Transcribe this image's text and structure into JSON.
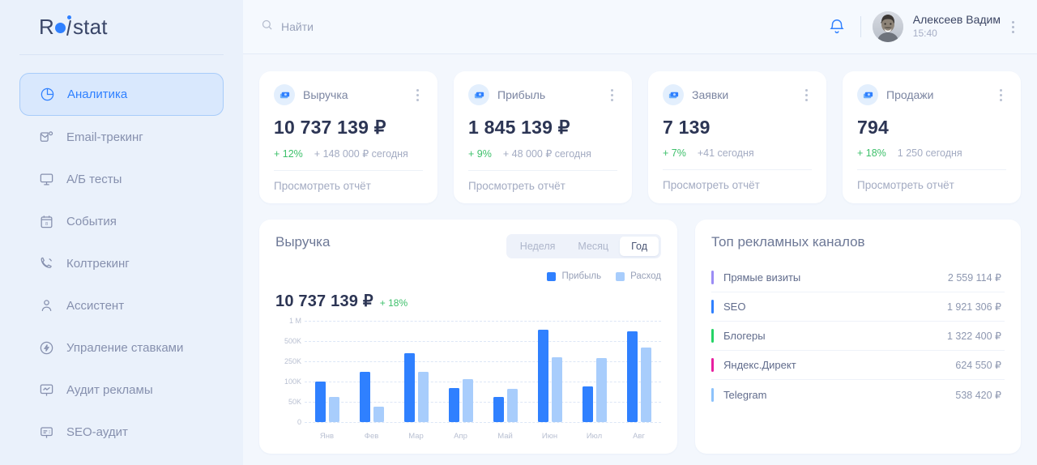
{
  "brand": {
    "logo_text": "Roistat",
    "accent": "#2f80ff"
  },
  "sidebar": {
    "items": [
      {
        "label": "Аналитика",
        "icon": "pie-chart-icon",
        "active": true
      },
      {
        "label": "Email-трекинг",
        "icon": "email-icon",
        "active": false
      },
      {
        "label": "A/Б тесты",
        "icon": "monitor-icon",
        "active": false
      },
      {
        "label": "События",
        "icon": "calendar-icon",
        "active": false
      },
      {
        "label": "Колтрекинг",
        "icon": "phone-icon",
        "active": false
      },
      {
        "label": "Ассистент",
        "icon": "user-check-icon",
        "active": false
      },
      {
        "label": "Упраление ставками",
        "icon": "bolt-circle-icon",
        "active": false
      },
      {
        "label": "Аудит рекламы",
        "icon": "presentation-icon",
        "active": false
      },
      {
        "label": "SEO-аудит",
        "icon": "document-icon",
        "active": false
      }
    ]
  },
  "topbar": {
    "search_placeholder": "Найти",
    "search_icon": "search-icon",
    "bell_icon": "bell-icon",
    "user": {
      "name": "Алексеев Вадим",
      "time": "15:40"
    },
    "menu_icon": "kebab-menu-icon"
  },
  "kpi_cards": [
    {
      "title": "Выручка",
      "value": "10 737 139 ₽",
      "delta": "+ 12%",
      "note": "+ 148 000 ₽ сегодня",
      "link": "Просмотреть отчёт",
      "icon": "money-icon"
    },
    {
      "title": "Прибыль",
      "value": "1 845 139 ₽",
      "delta": "+ 9%",
      "note": "+ 48 000 ₽ сегодня",
      "link": "Просмотреть отчёт",
      "icon": "money-icon"
    },
    {
      "title": "Заявки",
      "value": "7 139",
      "delta": "+ 7%",
      "note": "+41 сегодня",
      "link": "Просмотреть отчёт",
      "icon": "money-icon"
    },
    {
      "title": "Продажи",
      "value": "794",
      "delta": "+ 18%",
      "note": "1 250 сегодня",
      "link": "Просмотреть отчёт",
      "icon": "money-icon"
    }
  ],
  "revenue_panel": {
    "title": "Выручка",
    "value": "10 737 139 ₽",
    "delta": "+ 18%",
    "tabs": [
      {
        "label": "Неделя",
        "active": false
      },
      {
        "label": "Месяц",
        "active": false
      },
      {
        "label": "Год",
        "active": true
      }
    ]
  },
  "channels_panel": {
    "title": "Топ рекламных каналов",
    "rows": [
      {
        "name": "Прямые визиты",
        "value": "2 559 114 ₽",
        "color": "#9b8cf5"
      },
      {
        "name": "SEO",
        "value": "1 921 306 ₽",
        "color": "#2f80ff"
      },
      {
        "name": "Блогеры",
        "value": "1 322 400 ₽",
        "color": "#25d366"
      },
      {
        "name": "Яндекс.Директ",
        "value": "624 550 ₽",
        "color": "#e81fa0"
      },
      {
        "name": "Telegram",
        "value": "538 420 ₽",
        "color": "#8cc2fb"
      }
    ]
  },
  "chart_data": {
    "type": "bar",
    "title": "Выручка",
    "xlabel": "",
    "ylabel": "",
    "grid": true,
    "legend_position": "top-right",
    "categories": [
      "Янв",
      "Фев",
      "Мар",
      "Апр",
      "Май",
      "Июн",
      "Июл",
      "Авг"
    ],
    "ytick_labels": [
      "0",
      "50K",
      "100K",
      "250K",
      "500K",
      "1 M"
    ],
    "series": [
      {
        "name": "Прибыль",
        "color": "#2f80ff",
        "values": [
          100000,
          175000,
          350000,
          85000,
          62000,
          780000,
          88000,
          740000
        ]
      },
      {
        "name": "Расход",
        "color": "#a8cdfc",
        "values": [
          62000,
          38000,
          175000,
          120000,
          82000,
          300000,
          290000,
          420000
        ]
      }
    ]
  }
}
